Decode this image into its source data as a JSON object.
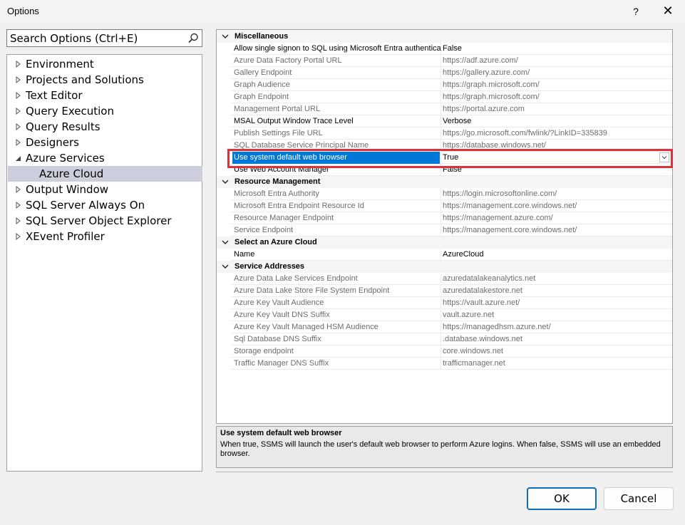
{
  "window": {
    "title": "Options",
    "help_glyph": "?",
    "close_glyph": "✕"
  },
  "search": {
    "placeholder": "Search Options (Ctrl+E)",
    "icon": "search-icon"
  },
  "tree": {
    "items": [
      {
        "label": "Environment",
        "state": "collapsed"
      },
      {
        "label": "Projects and Solutions",
        "state": "collapsed"
      },
      {
        "label": "Text Editor",
        "state": "collapsed"
      },
      {
        "label": "Query Execution",
        "state": "collapsed"
      },
      {
        "label": "Query Results",
        "state": "collapsed"
      },
      {
        "label": "Designers",
        "state": "collapsed"
      },
      {
        "label": "Azure Services",
        "state": "expanded"
      },
      {
        "label": "Azure Cloud",
        "state": "child",
        "selected": true
      },
      {
        "label": "Output Window",
        "state": "collapsed"
      },
      {
        "label": "SQL Server Always On",
        "state": "collapsed"
      },
      {
        "label": "SQL Server Object Explorer",
        "state": "collapsed"
      },
      {
        "label": "XEvent Profiler",
        "state": "collapsed"
      }
    ]
  },
  "grid": {
    "categories": [
      {
        "name": "Miscellaneous",
        "rows": [
          {
            "name": "Allow single signon to SQL using Microsoft Entra authenticati",
            "value": "False",
            "readonly": false
          },
          {
            "name": "Azure Data Factory Portal URL",
            "value": "https://adf.azure.com/",
            "readonly": true
          },
          {
            "name": "Gallery Endpoint",
            "value": "https://gallery.azure.com/",
            "readonly": true
          },
          {
            "name": "Graph Audience",
            "value": "https://graph.microsoft.com/",
            "readonly": true
          },
          {
            "name": "Graph Endpoint",
            "value": "https://graph.microsoft.com/",
            "readonly": true
          },
          {
            "name": "Management Portal URL",
            "value": "https://portal.azure.com",
            "readonly": true
          },
          {
            "name": "MSAL Output Window Trace Level",
            "value": "Verbose",
            "readonly": false
          },
          {
            "name": "Publish Settings File URL",
            "value": "https://go.microsoft.com/fwlink/?LinkID=335839",
            "readonly": true
          },
          {
            "name": "SQL Database Service Principal Name",
            "value": "https://database.windows.net/",
            "readonly": true
          },
          {
            "name": "Use system default web browser",
            "value": "True",
            "readonly": false,
            "selected": true
          },
          {
            "name": "Use Web Account Manager",
            "value": "False",
            "readonly": false
          }
        ]
      },
      {
        "name": "Resource Management",
        "rows": [
          {
            "name": "Microsoft Entra Authority",
            "value": "https://login.microsoftonline.com/",
            "readonly": true
          },
          {
            "name": "Microsoft Entra Endpoint Resource Id",
            "value": "https://management.core.windows.net/",
            "readonly": true
          },
          {
            "name": "Resource Manager Endpoint",
            "value": "https://management.azure.com/",
            "readonly": true
          },
          {
            "name": "Service Endpoint",
            "value": "https://management.core.windows.net/",
            "readonly": true
          }
        ]
      },
      {
        "name": "Select an Azure Cloud",
        "rows": [
          {
            "name": "Name",
            "value": "AzureCloud",
            "readonly": false
          }
        ]
      },
      {
        "name": "Service Addresses",
        "rows": [
          {
            "name": "Azure Data Lake Services Endpoint",
            "value": "azuredatalakeanalytics.net",
            "readonly": true
          },
          {
            "name": "Azure Data Lake Store File System Endpoint",
            "value": "azuredatalakestore.net",
            "readonly": true
          },
          {
            "name": "Azure Key Vault Audience",
            "value": "https://vault.azure.net/",
            "readonly": true
          },
          {
            "name": "Azure Key Vault DNS Suffix",
            "value": "vault.azure.net",
            "readonly": true
          },
          {
            "name": "Azure Key Vault Managed HSM Audience",
            "value": "https://managedhsm.azure.net/",
            "readonly": true
          },
          {
            "name": "Sql Database DNS Suffix",
            "value": ".database.windows.net",
            "readonly": true
          },
          {
            "name": "Storage endpoint",
            "value": "core.windows.net",
            "readonly": true
          },
          {
            "name": "Traffic Manager DNS Suffix",
            "value": "trafficmanager.net",
            "readonly": true
          }
        ]
      }
    ]
  },
  "description": {
    "title": "Use system default web browser",
    "text": "When true, SSMS will launch the user's default web browser to perform Azure logins. When false, SSMS will use an embedded browser."
  },
  "buttons": {
    "ok": "OK",
    "cancel": "Cancel"
  },
  "colors": {
    "selection": "#0078d7",
    "tree_selection": "#cccedb",
    "highlight_box": "#e0313b",
    "ok_border": "#0f6cbd"
  }
}
